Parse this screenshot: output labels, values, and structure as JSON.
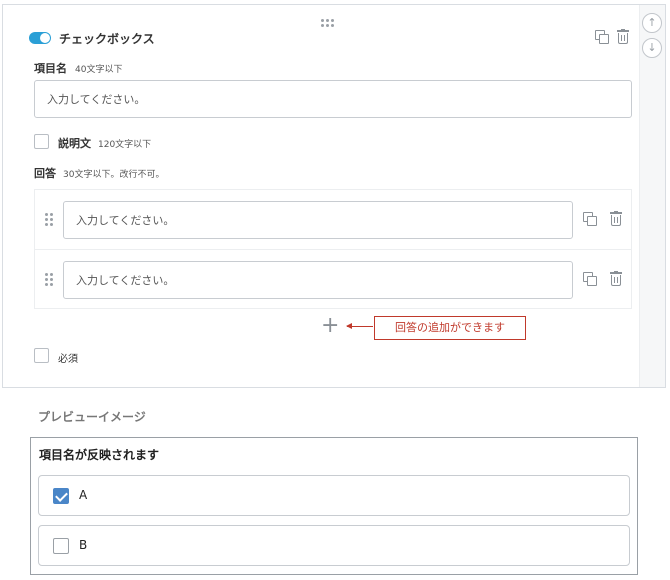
{
  "field": {
    "type_label": "チェックボックス",
    "toggle_on": true
  },
  "item_name": {
    "label": "項目名",
    "hint": "40文字以下",
    "placeholder": "入力してください。"
  },
  "description": {
    "label": "説明文",
    "hint": "120文字以下",
    "checked": false
  },
  "answers": {
    "label": "回答",
    "hint": "30文字以下。改行不可。",
    "items": [
      {
        "placeholder": "入力してください。"
      },
      {
        "placeholder": "入力してください。"
      }
    ],
    "add_symbol": "+",
    "add_annotation": "回答の追加ができます"
  },
  "required": {
    "label": "必須",
    "checked": false
  },
  "scroll": {
    "up_symbol": "↑",
    "down_symbol": "↓"
  },
  "preview": {
    "heading": "プレビューイメージ",
    "title": "項目名が反映されます",
    "options": [
      {
        "label": "A",
        "checked": true
      },
      {
        "label": "B",
        "checked": false
      }
    ]
  },
  "colors": {
    "toggle": "#2a9fd6",
    "annotation": "#c0392b",
    "checked_box": "#4a86c8"
  }
}
